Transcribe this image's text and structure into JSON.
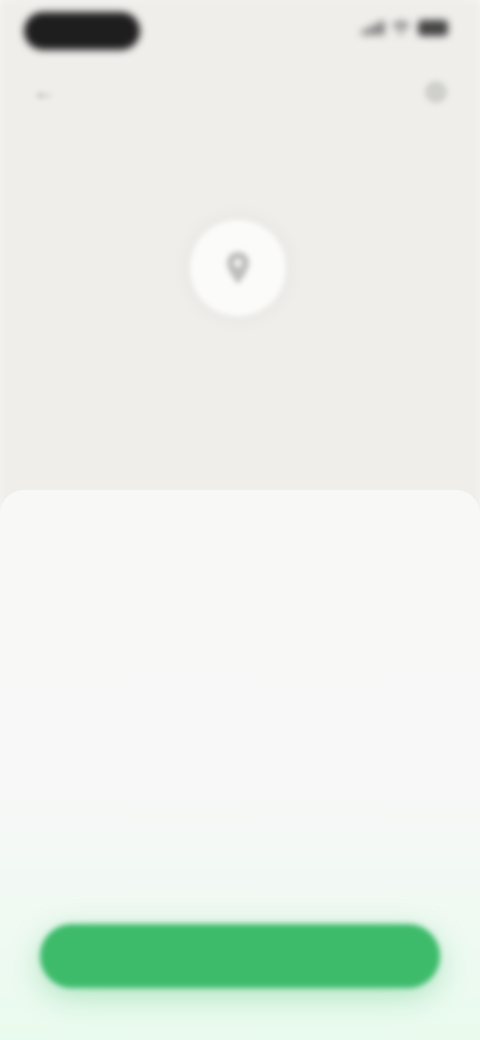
{
  "status_bar": {
    "time": "",
    "icons": [
      "signal-icon",
      "wifi-icon",
      "battery-icon"
    ]
  },
  "nav": {
    "back_icon": "back-arrow-icon",
    "help_icon": "help-icon"
  },
  "map": {
    "pin_icon": "location-pin-icon"
  },
  "sheet": {
    "title": "",
    "body_1": "",
    "body_2": "",
    "link": ""
  },
  "primary_button": {
    "label": ""
  },
  "colors": {
    "accent": "#3dbb6b",
    "map_background": "#efeeeb",
    "sheet_background": "#f8f8f7",
    "title_text": "#262626",
    "body_text": "#7d7d7d"
  }
}
